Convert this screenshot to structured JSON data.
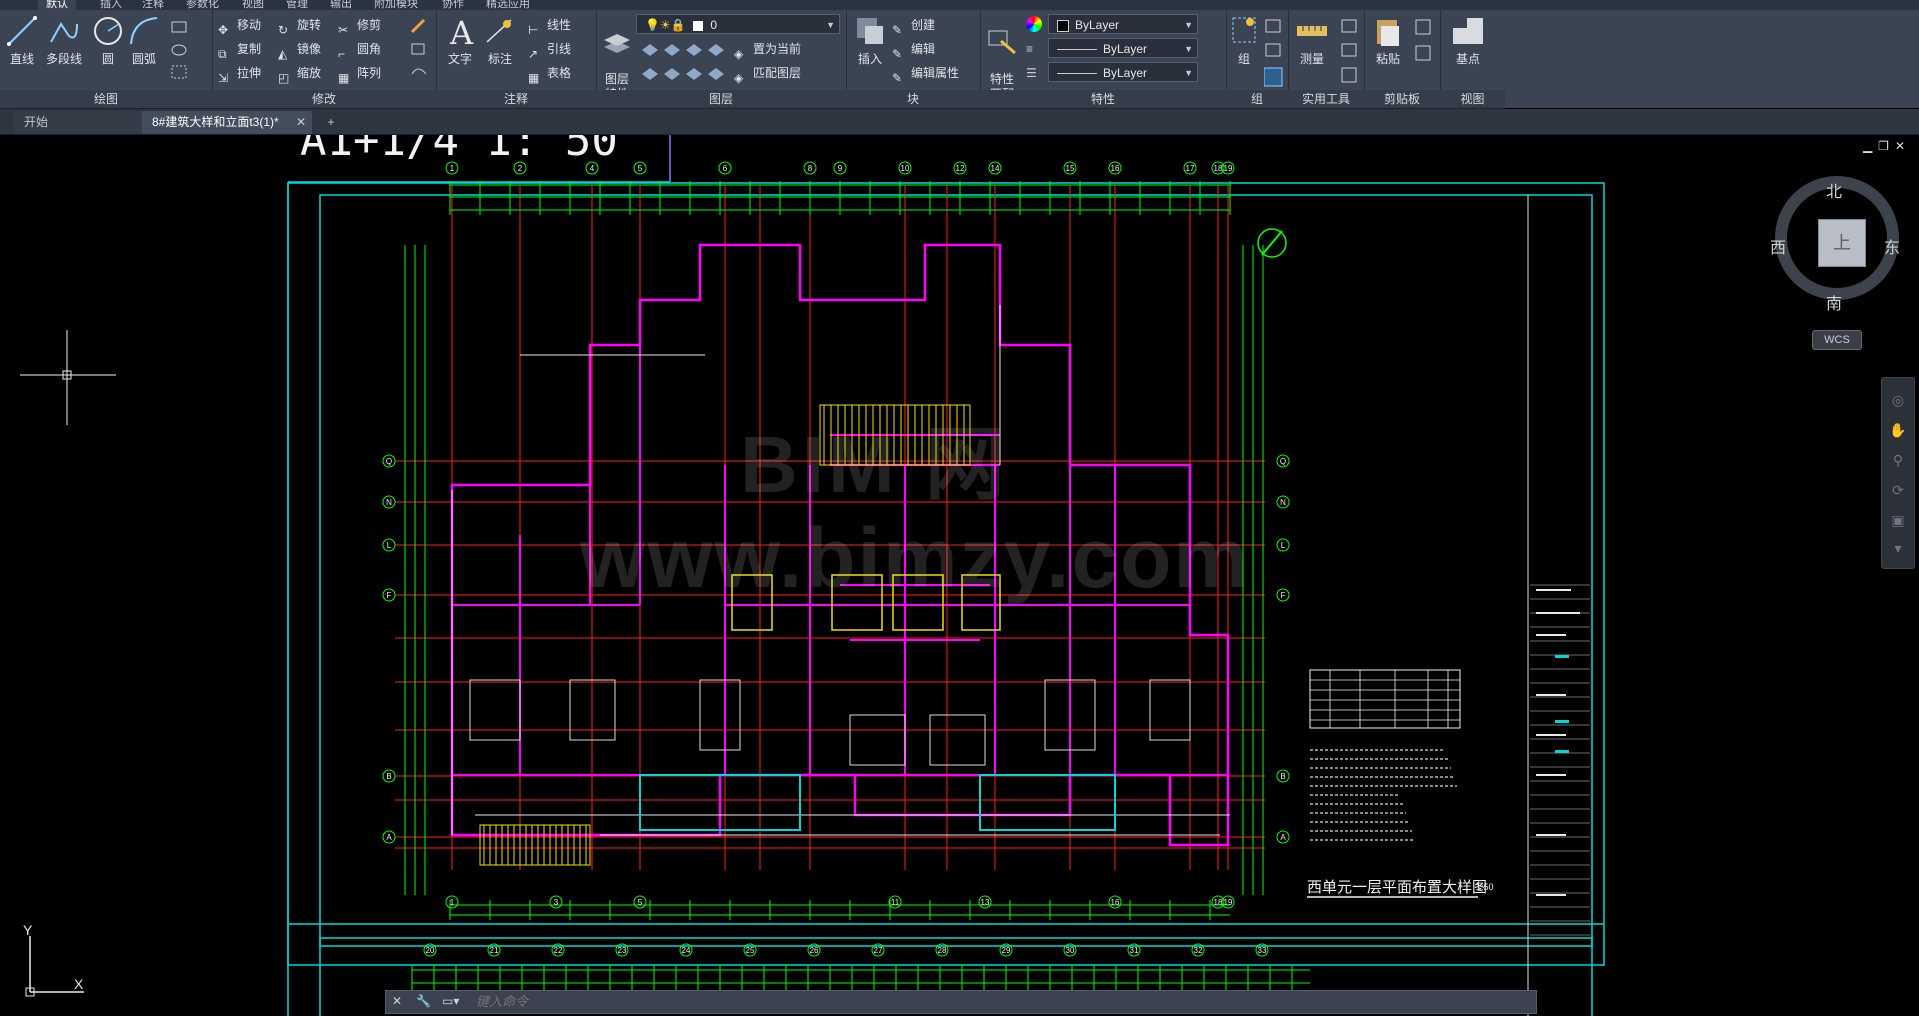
{
  "ribbon_tabs": [
    "默认",
    "插入",
    "注释",
    "参数化",
    "视图",
    "管理",
    "输出",
    "附加模块",
    "协作",
    "精选应用"
  ],
  "panels": {
    "draw": {
      "title": "绘图",
      "line": "直线",
      "polyline": "多段线",
      "circle": "圆",
      "arc": "圆弧"
    },
    "modify": {
      "title": "修改",
      "move": "移动",
      "rotate": "旋转",
      "trim": "修剪",
      "copy": "复制",
      "mirror": "镜像",
      "fillet": "圆角",
      "stretch": "拉伸",
      "scale": "缩放",
      "array": "阵列"
    },
    "annotation": {
      "title": "注释",
      "text": "文字",
      "dimension": "标注",
      "linear": "线性",
      "leader": "引线",
      "table": "表格"
    },
    "layers": {
      "title": "图层",
      "layer_props": "图层\n特性",
      "current_layer": "0",
      "set_current": "置为当前",
      "match_layer": "匹配图层"
    },
    "block": {
      "title": "块",
      "insert": "插入",
      "create": "创建",
      "edit": "编辑",
      "edit_attr": "编辑属性"
    },
    "properties": {
      "title": "特性",
      "match": "特性\n匹配",
      "color": "ByLayer",
      "linetype": "ByLayer",
      "lineweight": "ByLayer"
    },
    "groups": {
      "title": "组",
      "group": "组"
    },
    "utilities": {
      "title": "实用工具",
      "measure": "测量"
    },
    "clipboard": {
      "title": "剪贴板",
      "paste": "粘贴"
    },
    "view": {
      "title": "视图",
      "base": "基点"
    }
  },
  "doc_tabs": {
    "start": "开始",
    "drawing": "8#建筑大样和立面t3(1)*",
    "add": "+"
  },
  "drawing": {
    "header_label": "A1+1/4 1: 50",
    "plan_title": "西单元一层平面布置大样图",
    "plan_scale": "1:50",
    "watermark_line1": "BIM 网",
    "watermark_line2": "www.bimzy.com",
    "grid_top": [
      "1",
      "2",
      "4",
      "5",
      "6",
      "8",
      "9",
      "10",
      "12",
      "14",
      "15",
      "16",
      "17",
      "18",
      "19"
    ],
    "grid_bottom": [
      "1",
      "3",
      "5",
      "11",
      "13",
      "16",
      "18",
      "19"
    ],
    "grid_left": [
      "Q",
      "N",
      "L",
      "F",
      "B",
      "A"
    ],
    "grid_lower": [
      "20",
      "21",
      "22",
      "23",
      "24",
      "25",
      "26",
      "27",
      "28",
      "29",
      "30",
      "31",
      "32",
      "33"
    ]
  },
  "viewcube": {
    "north": "北",
    "south": "南",
    "west": "西",
    "east": "东",
    "top": "上",
    "wcs": "WCS"
  },
  "ucs": {
    "x": "X",
    "y": "Y"
  },
  "command": {
    "placeholder": "键入命令"
  },
  "colors": {
    "ribbon": "#3b4453",
    "canvas": "#000000",
    "frame": "#00d8d8",
    "grid": "#ff2020",
    "wall": "#ff00ff",
    "dim": "#00ff00"
  }
}
